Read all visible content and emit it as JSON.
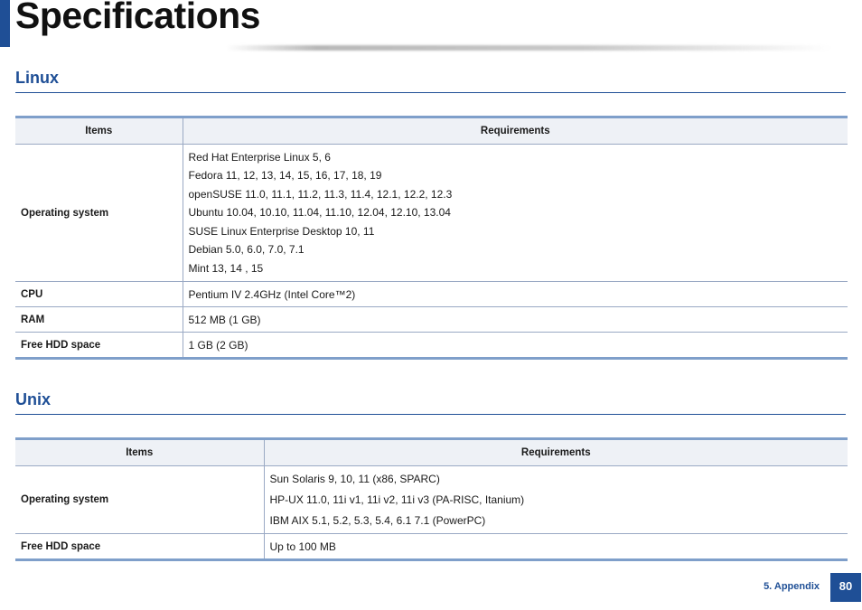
{
  "page": {
    "title": "Specifications",
    "accent_color": "#1f4f96"
  },
  "linux": {
    "heading": "Linux",
    "header": {
      "items": "Items",
      "requirements": "Requirements"
    },
    "rows": [
      {
        "item": "Operating system",
        "lines": [
          "Red Hat Enterprise Linux 5, 6",
          "Fedora 11, 12, 13, 14, 15, 16, 17, 18, 19",
          "openSUSE 11.0, 11.1, 11.2, 11.3, 11.4, 12.1, 12.2, 12.3",
          "Ubuntu 10.04, 10.10, 11.04, 11.10, 12.04, 12.10, 13.04",
          "SUSE Linux Enterprise Desktop 10, 11",
          "Debian 5.0, 6.0, 7.0, 7.1",
          "Mint 13, 14 , 15"
        ]
      },
      {
        "item": "CPU",
        "value": "Pentium IV 2.4GHz (Intel Core™2)"
      },
      {
        "item": "RAM",
        "value": "512 MB (1 GB)"
      },
      {
        "item": "Free HDD space",
        "value": "1 GB (2 GB)"
      }
    ]
  },
  "unix": {
    "heading": "Unix",
    "header": {
      "items": "Items",
      "requirements": "Requirements"
    },
    "rows": [
      {
        "item": "Operating system",
        "lines": [
          "Sun Solaris 9, 10, 11 (x86, SPARC)",
          "HP-UX 11.0, 11i v1, 11i v2, 11i v3 (PA-RISC, Itanium)",
          "IBM AIX 5.1, 5.2, 5.3, 5.4, 6.1 7.1 (PowerPC)"
        ]
      },
      {
        "item": "Free HDD space",
        "value": "Up to 100 MB"
      }
    ]
  },
  "footer": {
    "section_label": "5.  Appendix",
    "page_number": "80"
  }
}
